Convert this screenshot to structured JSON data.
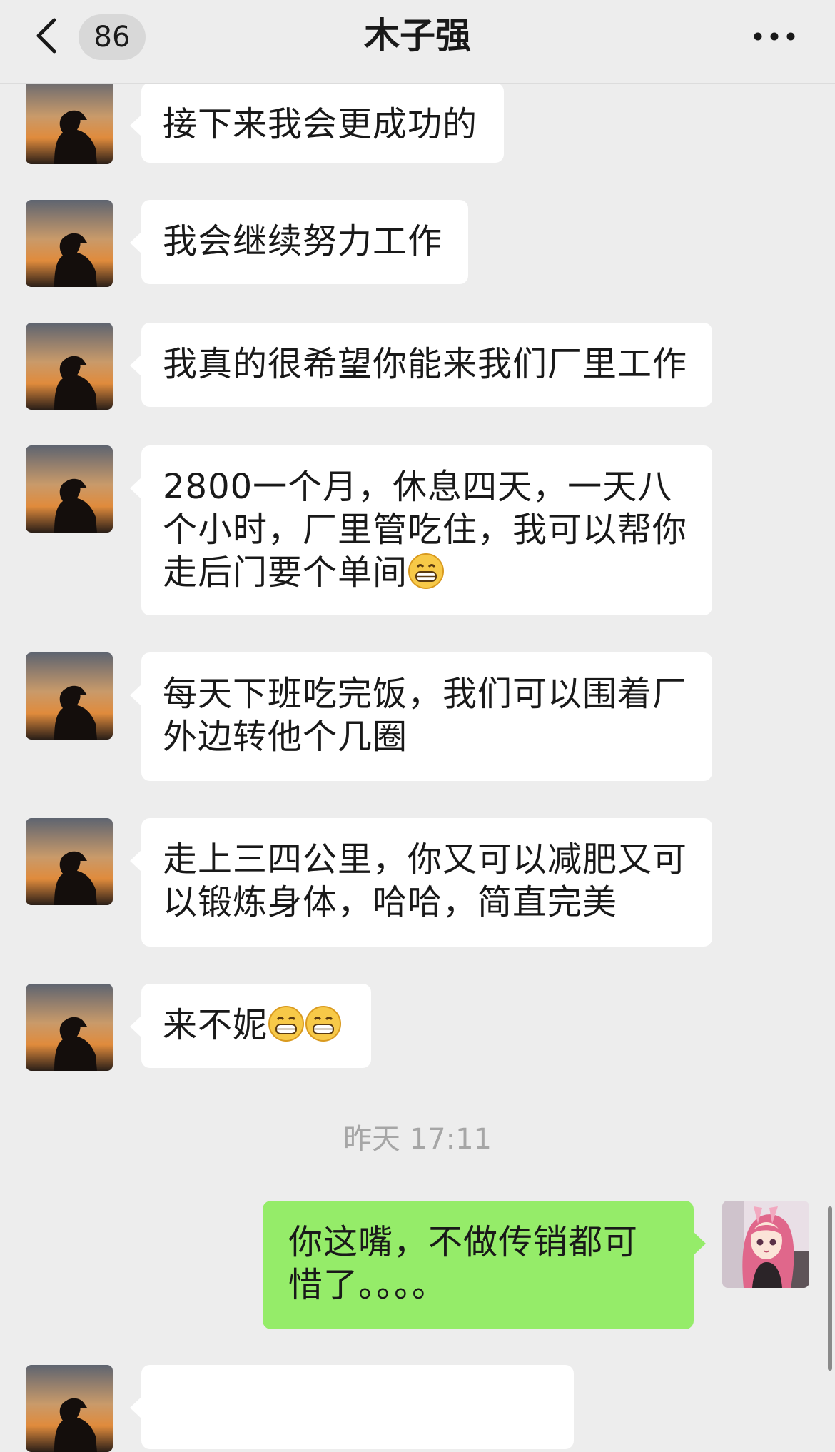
{
  "header": {
    "back_icon": "chevron-left-icon",
    "unread_count": "86",
    "title": "木子强",
    "more_icon": "more-horizontal-icon"
  },
  "messages": [
    {
      "sender": "contact",
      "text": "接下来我会更成功的",
      "emoji_count": 0
    },
    {
      "sender": "contact",
      "text": "我会继续努力工作",
      "emoji_count": 0
    },
    {
      "sender": "contact",
      "text": "我真的很希望你能来我们厂里工作",
      "emoji_count": 0
    },
    {
      "sender": "contact",
      "text": "2800一个月，休息四天，一天八个小时，厂里管吃住，我可以帮你走后门要个单间",
      "emoji_count": 1
    },
    {
      "sender": "contact",
      "text": "每天下班吃完饭，我们可以围着厂外边转他个几圈",
      "emoji_count": 0
    },
    {
      "sender": "contact",
      "text": "走上三四公里，你又可以减肥又可以锻炼身体，哈哈，简直完美",
      "emoji_count": 0
    },
    {
      "sender": "contact",
      "text": "来不妮",
      "emoji_count": 2
    },
    {
      "sender": "me",
      "text": "你这嘴，不做传销都可惜了。。。。",
      "emoji_count": 0
    }
  ],
  "timestamp": "昨天 17:11",
  "colors": {
    "background": "#ededed",
    "incoming_bubble": "#ffffff",
    "outgoing_bubble": "#95ec69",
    "timestamp_text": "#a6a6a6"
  },
  "icons": {
    "contact_avatar": "silhouette-sunset-avatar",
    "my_avatar": "anime-girl-avatar",
    "emoji": "grinning-face-emoji"
  }
}
